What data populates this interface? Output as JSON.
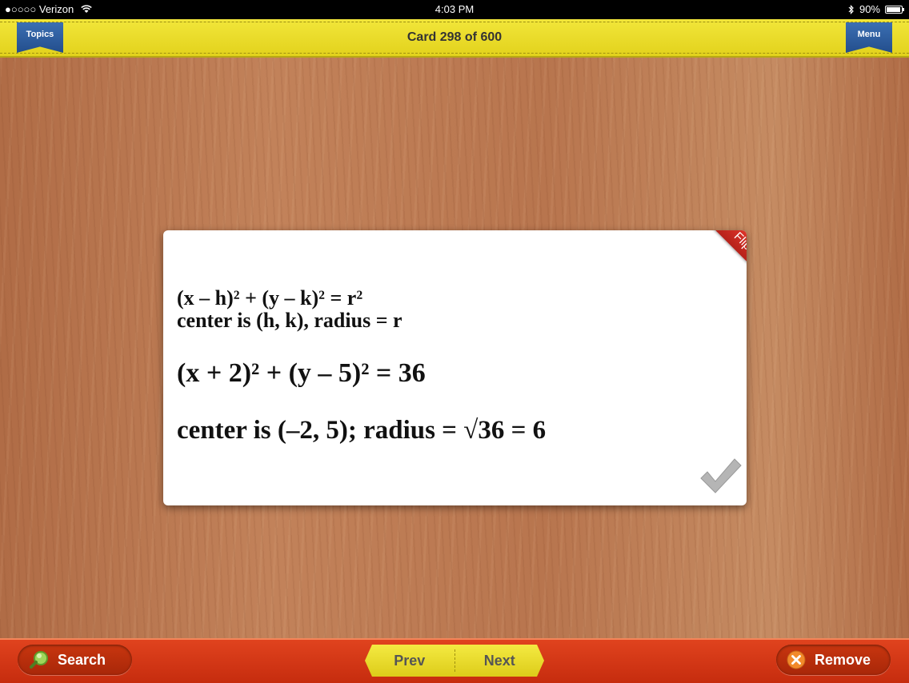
{
  "status_bar": {
    "carrier": "●○○○○ Verizon",
    "time": "4:03 PM",
    "battery": "90%"
  },
  "header": {
    "title": "Card 298 of 600",
    "topics_label": "Topics",
    "menu_label": "Menu"
  },
  "card": {
    "flip_label": "Flip",
    "line1": "(x – h)² + (y – k)² = r²",
    "line2": "center is (h, k), radius = r",
    "line3": "(x + 2)² + (y – 5)² = 36",
    "line4": "center is (–2, 5); radius = √36 = 6"
  },
  "footer": {
    "search_label": "Search",
    "prev_label": "Prev",
    "next_label": "Next",
    "remove_label": "Remove"
  },
  "colors": {
    "topbar": "#e9dc2a",
    "bottombar": "#d5381a",
    "ribbon": "#2f5f9f",
    "flip": "#d42e24",
    "search_icon": "#7ac142",
    "remove_icon": "#f07a1e"
  },
  "icons": {
    "status": [
      "wifi-icon",
      "bluetooth-icon",
      "battery-icon"
    ],
    "search": "magnifier-icon",
    "remove": "x-circle-icon",
    "card": "checkmark-icon"
  }
}
